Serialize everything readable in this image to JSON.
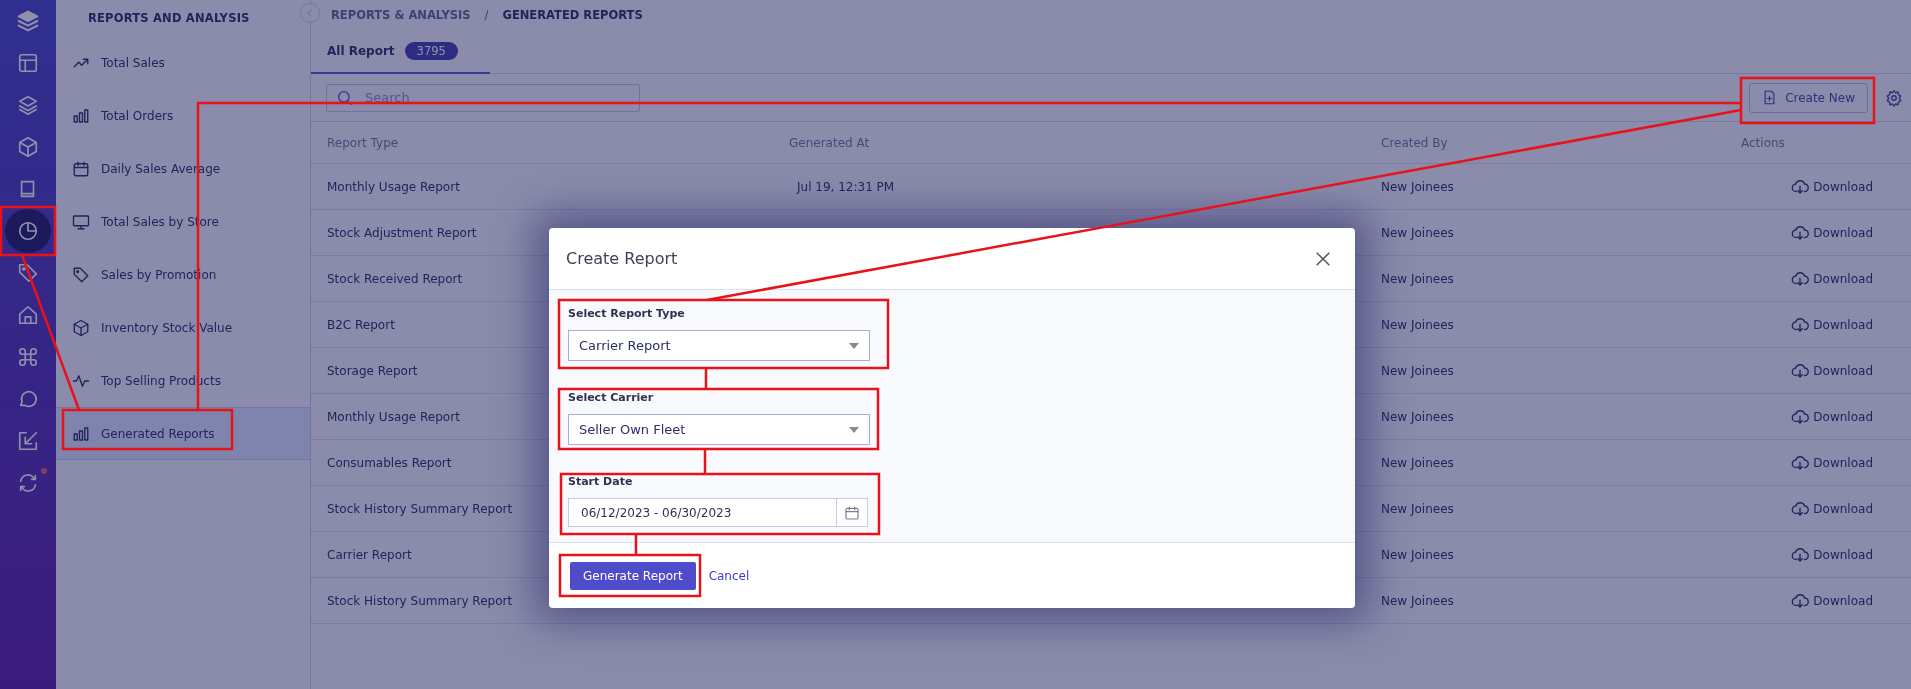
{
  "rail": {
    "items": [
      {
        "selected": false
      },
      {
        "selected": false
      },
      {
        "selected": false
      },
      {
        "selected": false
      },
      {
        "selected": false
      },
      {
        "selected": true
      },
      {
        "selected": false
      },
      {
        "selected": false
      },
      {
        "selected": false
      },
      {
        "selected": false
      },
      {
        "selected": false
      },
      {
        "selected": false
      }
    ]
  },
  "menu": {
    "title": "REPORTS AND ANALYSIS",
    "items": [
      {
        "label": "Total Sales",
        "selected": false
      },
      {
        "label": "Total Orders",
        "selected": false
      },
      {
        "label": "Daily Sales Average",
        "selected": false
      },
      {
        "label": "Total Sales by Store",
        "selected": false
      },
      {
        "label": "Sales by Promotion",
        "selected": false
      },
      {
        "label": "Inventory Stock Value",
        "selected": false
      },
      {
        "label": "Top Selling Products",
        "selected": false
      },
      {
        "label": "Generated Reports",
        "selected": true
      }
    ]
  },
  "breadcrumb": {
    "items": [
      "REPORTS & ANALYSIS",
      "GENERATED REPORTS"
    ],
    "separator": "/"
  },
  "tabs": [
    {
      "label": "All Report",
      "count": "3795",
      "selected": true
    }
  ],
  "search": {
    "placeholder": "Search"
  },
  "create_button": "Create New",
  "table": {
    "columns": [
      "Report Type",
      "Generated At",
      "Created By",
      "Actions"
    ],
    "rows": [
      {
        "report_type": "Monthly Usage Report",
        "generated_at": "Jul 19, 12:31 PM",
        "created_by": "New Joinees",
        "action": "Download"
      },
      {
        "report_type": "Stock Adjustment Report",
        "created_by": "New Joinees",
        "action": "Download"
      },
      {
        "report_type": "Stock Received Report",
        "created_by": "New Joinees",
        "action": "Download"
      },
      {
        "report_type": "B2C Report",
        "created_by": "New Joinees",
        "action": "Download"
      },
      {
        "report_type": "Storage Report",
        "created_by": "New Joinees",
        "action": "Download"
      },
      {
        "report_type": "Monthly Usage Report",
        "created_by": "New Joinees",
        "action": "Download"
      },
      {
        "report_type": "Consumables Report",
        "created_by": "New Joinees",
        "action": "Download"
      },
      {
        "report_type": "Stock History Summary Report",
        "created_by": "New Joinees",
        "action": "Download"
      },
      {
        "report_type": "Carrier Report",
        "created_by": "New Joinees",
        "action": "Download"
      },
      {
        "report_type": "Stock History Summary Report",
        "created_by": "New Joinees",
        "action": "Download"
      }
    ]
  },
  "modal": {
    "title": "Create Report",
    "fields": [
      {
        "kind": "select",
        "label": "Select Report Type",
        "value": "Carrier Report"
      },
      {
        "kind": "select",
        "label": "Select Carrier",
        "value": "Seller Own Fleet"
      },
      {
        "kind": "date",
        "label": "Start Date",
        "value": "06/12/2023 - 06/30/2023"
      }
    ],
    "primary_button": "Generate Report",
    "cancel_link": "Cancel"
  }
}
